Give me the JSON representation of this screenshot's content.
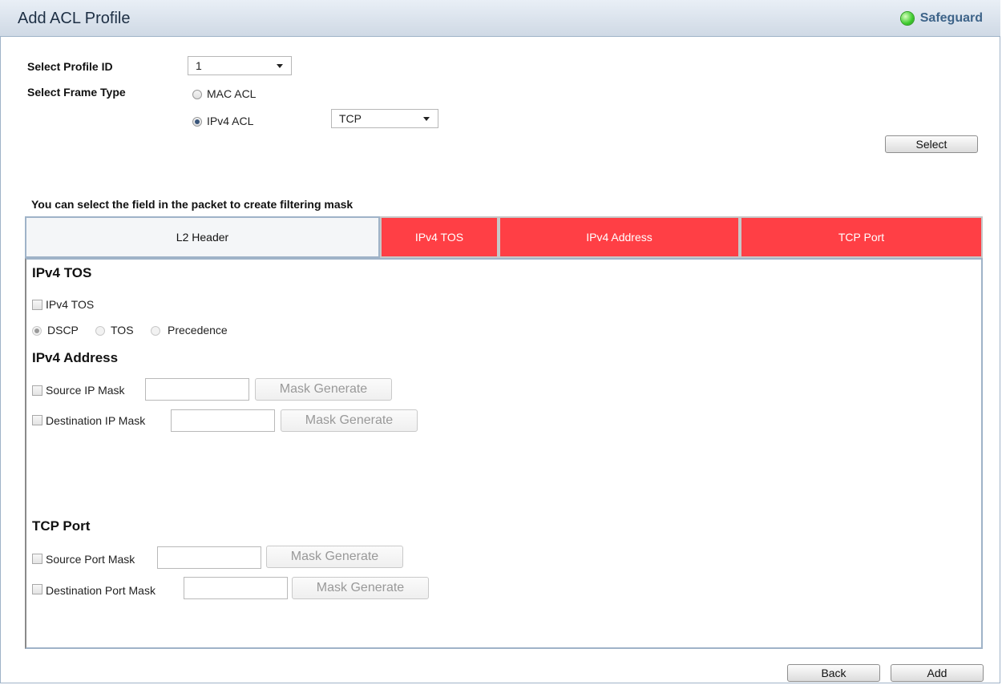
{
  "header": {
    "title": "Add ACL Profile",
    "safeguard_label": "Safeguard"
  },
  "profile": {
    "profile_id_label": "Select Profile ID",
    "profile_id_value": "1",
    "frame_type_label": "Select Frame Type",
    "mac_acl_label": "MAC ACL",
    "ipv4_acl_label": "IPv4 ACL",
    "protocol_value": "TCP",
    "select_button": "Select"
  },
  "hint": "You can select the field in the packet to create filtering mask",
  "tabs": [
    {
      "label": "L2 Header"
    },
    {
      "label": "IPv4 TOS"
    },
    {
      "label": "IPv4 Address"
    },
    {
      "label": "TCP Port"
    }
  ],
  "tos": {
    "title": "IPv4 TOS",
    "checkbox_label": "IPv4 TOS",
    "options": [
      "DSCP",
      "TOS",
      "Precedence"
    ]
  },
  "address": {
    "title": "IPv4 Address",
    "source_label": "Source IP Mask",
    "dest_label": "Destination IP Mask",
    "mask_button": "Mask Generate"
  },
  "port": {
    "title": "TCP Port",
    "source_label": "Source Port Mask",
    "dest_label": "Destination Port Mask",
    "mask_button": "Mask Generate"
  },
  "footer": {
    "back": "Back",
    "add": "Add"
  },
  "colors": {
    "tab_selected": "#ff3f45",
    "frame_border": "#9fb3c8",
    "status_ok": "#3dcb2d"
  }
}
